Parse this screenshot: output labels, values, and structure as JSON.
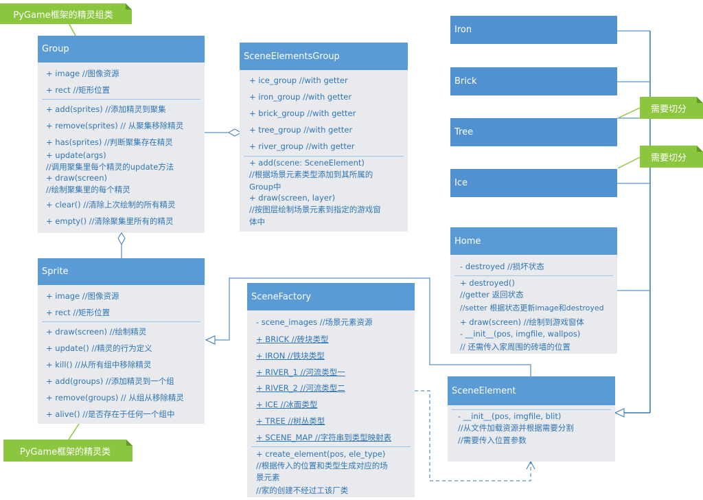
{
  "notes": {
    "group_note": "PyGame框架的精灵组类",
    "sprite_note": "PyGame框架的精灵类",
    "cut_note_1": "需要切分",
    "cut_note_2": "需要切分"
  },
  "group": {
    "title": "Group",
    "attributes": [
      "+ image //图像资源",
      "+ rect //矩形位置"
    ],
    "methods": [
      "+ add(sprites) //添加精灵到聚集",
      "+ remove(sprites) // 从聚集移除精灵",
      "+ has(sprites) //判断聚集存在精灵",
      "+ update(args)",
      "//调用聚集里每个精灵的update方法",
      "+ draw(screen)",
      "//绘制聚集里的每个精灵",
      "+ clear() //清除上次绘制的所有精灵",
      "+ empty() //清除聚集里所有的精灵"
    ]
  },
  "scene_elements_group": {
    "title": "SceneElementsGroup",
    "attributes": [
      "+ ice_group //with getter",
      "+ iron_group //with getter",
      "+ brick_group //with getter",
      "+ tree_group //with getter",
      "+ river_group //with getter"
    ],
    "methods": [
      "+ add(scene: SceneElement)",
      "//根据场景元素类型添加到其所属的",
      "Group中",
      "+ draw(screen, layer)",
      "//按图层绘制场景元素到指定的游戏窗",
      "体中"
    ]
  },
  "sprite": {
    "title": "Sprite",
    "attributes": [
      "+ image //图像资源",
      "+ rect //矩形位置"
    ],
    "methods": [
      "+ draw(screen) //绘制精灵",
      "+ update() //精灵的行为定义",
      "+ kill() //从所有组中移除精灵",
      "+ add(groups) //添加精灵到一个组",
      "+ remove(groups) // 从组从移除精灵",
      "+ alive() //是否存在于任何一个组中"
    ]
  },
  "scene_factory": {
    "title": "SceneFactory",
    "attributes": [
      "- scene_images //场景元素资源",
      "+ BRICK //砖块类型",
      "+ IRON //铁块类型",
      "+ RIVER_1 //河流类型一",
      "+ RIVER_2 //河流类型二",
      "+ ICE //冰面类型",
      "+ TREE //树丛类型",
      "+ SCENE_MAP //字符串到类型映射表"
    ],
    "methods": [
      "+ create_element(pos, ele_type)",
      "//根据传入的位置和类型生成对应的场",
      "景元素",
      "//家的创建不经过工该厂类"
    ]
  },
  "iron": {
    "title": "Iron"
  },
  "brick": {
    "title": "Brick"
  },
  "tree": {
    "title": "Tree"
  },
  "ice": {
    "title": "Ice"
  },
  "home": {
    "title": "Home",
    "attributes": [
      "- destroyed //损坏状态"
    ],
    "methods": [
      "+ destroyed()",
      "//getter 返回状态",
      "//setter 根据状态更新image和destroyed",
      "+ draw(screen) //绘制到游戏窗体",
      "- __init__(pos, imgfile, wallpos)",
      "// 还需传入家周围的砖墙的位置"
    ]
  },
  "scene_element": {
    "title": "SceneElement",
    "methods": [
      "- __init__(pos, imgfile, blit)",
      "//从文件加载资源并根据需要分割",
      "//需要传入位置参数"
    ]
  }
}
